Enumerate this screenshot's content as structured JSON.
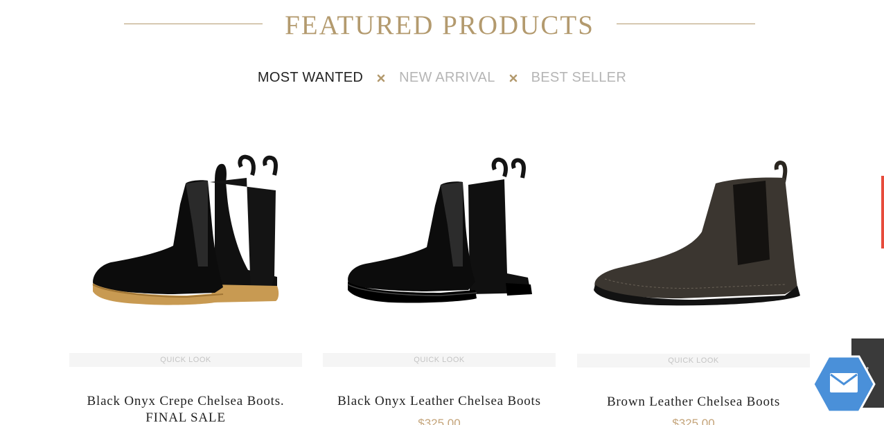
{
  "heading": {
    "title": "FEATURED PRODUCTS"
  },
  "tabs": [
    {
      "label": "MOST WANTED",
      "active": true
    },
    {
      "label": "NEW ARRIVAL",
      "active": false
    },
    {
      "label": "BEST SELLER",
      "active": false
    }
  ],
  "products": [
    {
      "name_line1": "Black Onyx Crepe Chelsea Boots.",
      "name_line2": "FINAL SALE",
      "price": "",
      "quick_look": "QUICK LOOK"
    },
    {
      "name_line1": "Black Onyx Leather Chelsea Boots",
      "name_line2": "",
      "price": "$325.00",
      "quick_look": "QUICK LOOK"
    },
    {
      "name_line1": "Brown Leather Chelsea Boots",
      "name_line2": "",
      "price": "$325.00",
      "quick_look": "QUICK LOOK"
    }
  ],
  "colors": {
    "accent_gold": "#b39a6e",
    "price_gold": "#c4a47a",
    "mail_blue": "#4a90d9"
  },
  "icons": {
    "tab_separator": "x-mark-icon",
    "scroll_top": "arrow-up-icon",
    "mail": "envelope-icon"
  }
}
